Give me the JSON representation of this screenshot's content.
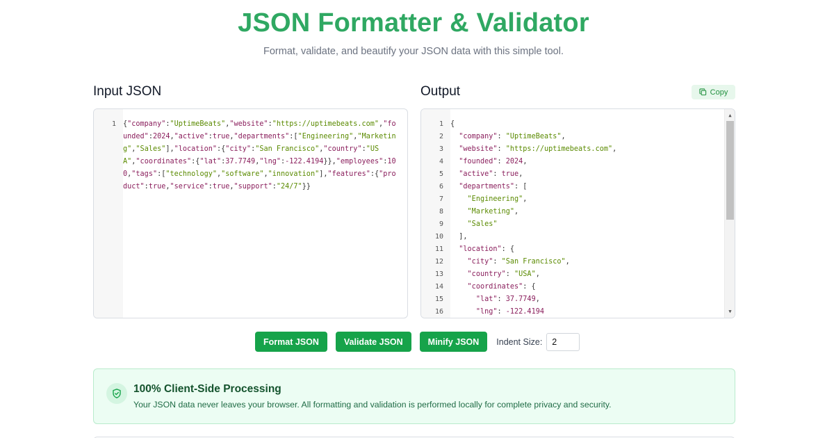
{
  "header": {
    "title": "JSON Formatter & Validator",
    "subtitle": "Format, validate, and beautify your JSON data with this simple tool."
  },
  "input_panel": {
    "title": "Input JSON",
    "line_numbers": [
      "1"
    ],
    "content": "{\"company\":\"UptimeBeats\",\"website\":\"https://uptimebeats.com\",\"founded\":2024,\"active\":true,\"departments\":[\"Engineering\",\"Marketing\",\"Sales\"],\"location\":{\"city\":\"San Francisco\",\"country\":\"USA\",\"coordinates\":{\"lat\":37.7749,\"lng\":-122.4194}},\"employees\":100,\"tags\":[\"technology\",\"software\",\"innovation\"],\"features\":{\"product\":true,\"service\":true,\"support\":\"24/7\"}}"
  },
  "output_panel": {
    "title": "Output",
    "copy_label": "Copy",
    "lines": [
      {
        "n": "1",
        "text": "{"
      },
      {
        "n": "2",
        "text": "  \"company\": \"UptimeBeats\","
      },
      {
        "n": "3",
        "text": "  \"website\": \"https://uptimebeats.com\","
      },
      {
        "n": "4",
        "text": "  \"founded\": 2024,"
      },
      {
        "n": "5",
        "text": "  \"active\": true,"
      },
      {
        "n": "6",
        "text": "  \"departments\": ["
      },
      {
        "n": "7",
        "text": "    \"Engineering\","
      },
      {
        "n": "8",
        "text": "    \"Marketing\","
      },
      {
        "n": "9",
        "text": "    \"Sales\""
      },
      {
        "n": "10",
        "text": "  ],"
      },
      {
        "n": "11",
        "text": "  \"location\": {"
      },
      {
        "n": "12",
        "text": "    \"city\": \"San Francisco\","
      },
      {
        "n": "13",
        "text": "    \"country\": \"USA\","
      },
      {
        "n": "14",
        "text": "    \"coordinates\": {"
      },
      {
        "n": "15",
        "text": "      \"lat\": 37.7749,"
      },
      {
        "n": "16",
        "text": "      \"lng\": -122.4194"
      }
    ]
  },
  "actions": {
    "format_label": "Format JSON",
    "validate_label": "Validate JSON",
    "minify_label": "Minify JSON",
    "indent_label": "Indent Size:",
    "indent_value": "2"
  },
  "privacy": {
    "icon": "shield-check-icon",
    "title": "100% Client-Side Processing",
    "text": "Your JSON data never leaves your browser. All formatting and validation is performed locally for complete privacy and security."
  },
  "colors": {
    "brand_green": "#2fa862",
    "button_green": "#16a34a",
    "json_key": "#8a1e5c",
    "json_string": "#5a8a00"
  }
}
